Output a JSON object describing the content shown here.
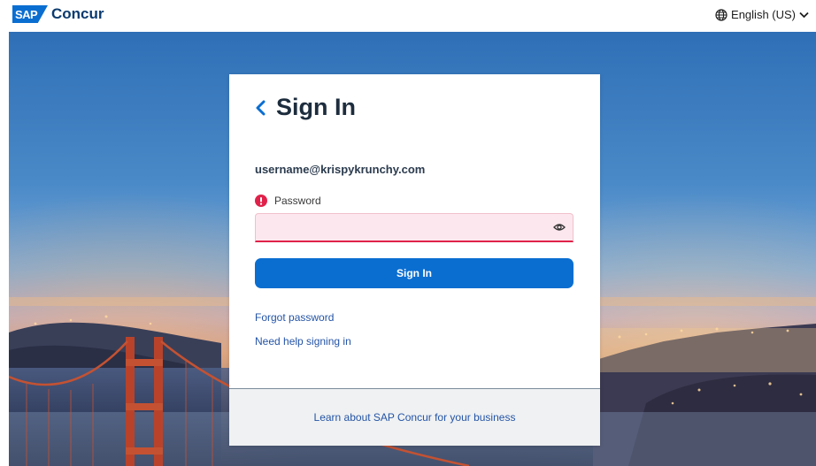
{
  "header": {
    "brand_badge": "SAP",
    "brand_name": "Concur",
    "language": "English (US)"
  },
  "login": {
    "title": "Sign In",
    "username": "username@krispykrunchy.com",
    "password_label": "Password",
    "password_value": "",
    "signin_button": "Sign In",
    "forgot_password": "Forgot password",
    "need_help": "Need help signing in"
  },
  "footer": {
    "learn_link": "Learn about SAP Concur for your business"
  },
  "colors": {
    "accent": "#0a6ed1",
    "error": "#e0224a",
    "error_field_bg": "#fde7ee",
    "link": "#2454a6"
  },
  "icons": [
    "globe-icon",
    "chevron-down-icon",
    "back-chevron-icon",
    "error-icon",
    "eye-icon"
  ]
}
